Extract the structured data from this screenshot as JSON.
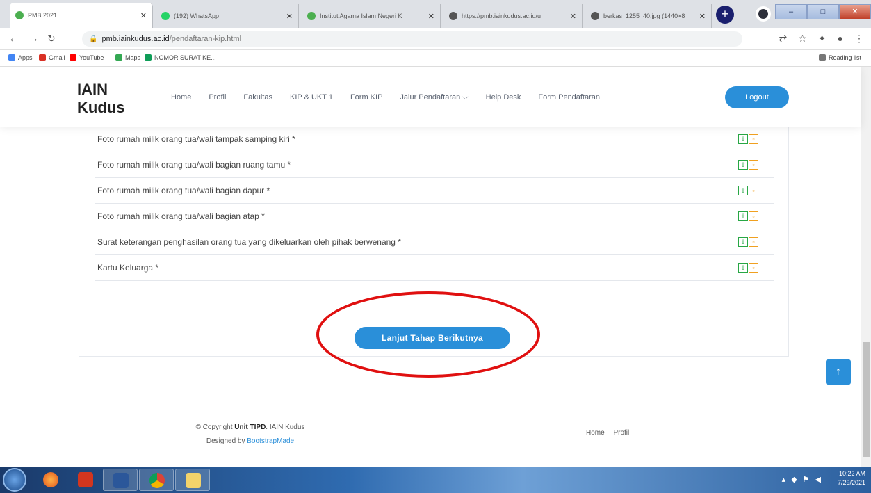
{
  "browser": {
    "tabs": [
      {
        "title": "PMB 2021",
        "favicon_color": "#4caf50",
        "active": true
      },
      {
        "title": "(192) WhatsApp",
        "favicon_color": "#25d366",
        "active": false
      },
      {
        "title": "Institut Agama Islam Negeri K",
        "favicon_color": "#4caf50",
        "active": false
      },
      {
        "title": "https://pmb.iainkudus.ac.id/u",
        "favicon_color": "#555555",
        "active": false
      },
      {
        "title": "berkas_1255_40.jpg (1440×8",
        "favicon_color": "#555555",
        "active": false
      }
    ],
    "new_tab_label": "+",
    "url_host": "pmb.iainkudus.ac.id",
    "url_path": "/pendaftaran-kip.html",
    "bookmarks": [
      {
        "label": "Apps",
        "color": "#4285f4"
      },
      {
        "label": "Gmail",
        "color": "#d93025"
      },
      {
        "label": "YouTube",
        "color": "#ff0000"
      },
      {
        "label": "Maps",
        "color": "#34a853"
      },
      {
        "label": "NOMOR SURAT KE...",
        "color": "#0f9d58"
      }
    ],
    "reading_list": "Reading list"
  },
  "site": {
    "logo_line1": "IAIN",
    "logo_line2": "Kudus",
    "nav": [
      "Home",
      "Profil",
      "Fakultas",
      "KIP & UKT 1",
      "Form KIP",
      "Jalur Pendaftaran ⌵",
      "Help Desk",
      "Form Pendaftaran"
    ],
    "logout_label": "Logout"
  },
  "documents": [
    "Foto rumah milik orang tua/wali tampak samping kiri *",
    "Foto rumah milik orang tua/wali bagian ruang tamu *",
    "Foto rumah milik orang tua/wali bagian dapur *",
    "Foto rumah milik orang tua/wali bagian atap *",
    "Surat keterangan penghasilan orang tua yang dikeluarkan oleh pihak berwenang *",
    "Kartu Keluarga *"
  ],
  "next_button_label": "Lanjut Tahap Berikutnya",
  "footer": {
    "copyright_prefix": "© Copyright ",
    "copyright_bold": "Unit TIPD",
    "copyright_suffix": ". IAIN Kudus",
    "designed_by": "Designed by ",
    "designer": "BootstrapMade",
    "links": [
      "Home",
      "Profil"
    ]
  },
  "back_to_top_label": "↑",
  "taskbar": {
    "time": "10:22 AM",
    "date": "7/29/2021"
  },
  "colors": {
    "accent": "#2a8fd9",
    "highlight_ellipse": "#e01010",
    "upload_icon": "#28a745",
    "delete_icon": "#f0a020"
  }
}
